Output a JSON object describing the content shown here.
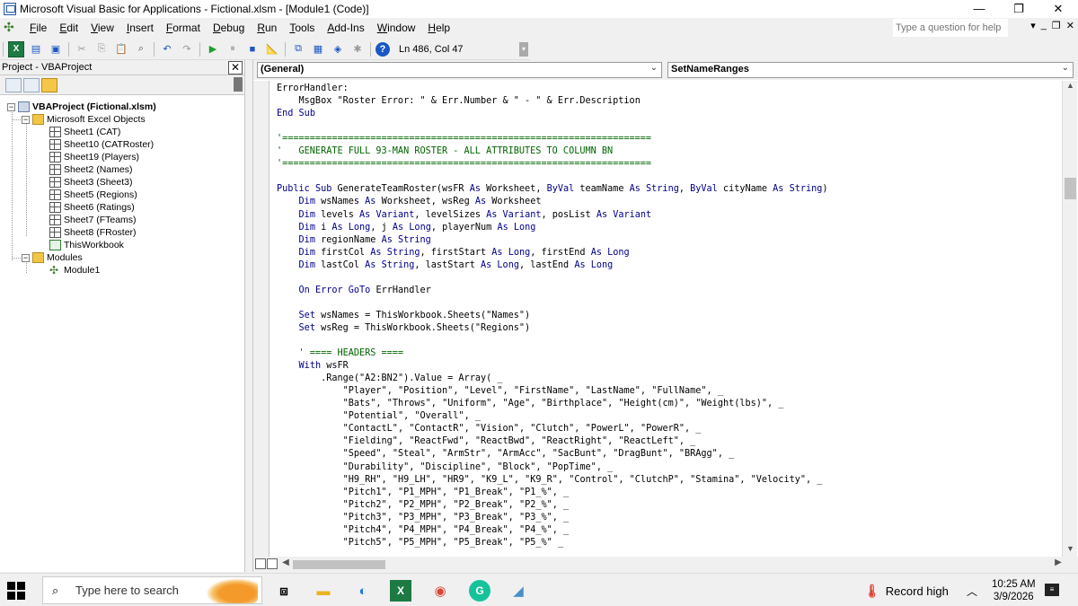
{
  "window": {
    "title": "Microsoft Visual Basic for Applications - Fictional.xlsm - [Module1 (Code)]",
    "controls": {
      "minimize": "—",
      "restore": "❐",
      "close": "✕"
    }
  },
  "menubar": {
    "items": [
      "File",
      "Edit",
      "View",
      "Insert",
      "Format",
      "Debug",
      "Run",
      "Tools",
      "Add-Ins",
      "Window",
      "Help"
    ],
    "help_placeholder": "Type a question for help",
    "mdi": {
      "dropdown": "▾",
      "minimize": "_",
      "restore": "❐",
      "close": "✕"
    }
  },
  "toolbar": {
    "cursor_position": "Ln 486, Col 47",
    "icons": [
      "excel-view-icon",
      "insert-module-icon",
      "save-icon",
      "cut-icon",
      "copy-icon",
      "paste-icon",
      "find-icon",
      "undo-icon",
      "redo-icon",
      "run-icon",
      "break-icon",
      "reset-icon",
      "design-mode-icon",
      "project-explorer-icon",
      "properties-icon",
      "object-browser-icon",
      "toolbox-icon",
      "help-icon"
    ]
  },
  "project_panel": {
    "title": "Project - VBAProject",
    "close_label": "✕",
    "tree": [
      {
        "label": "VBAProject (Fictional.xlsm)",
        "icon": "project",
        "expander": "−",
        "bold": true
      },
      {
        "label": "Microsoft Excel Objects",
        "icon": "folder",
        "expander": "−"
      },
      {
        "label": "Sheet1 (CAT)",
        "icon": "sheet"
      },
      {
        "label": "Sheet10 (CATRoster)",
        "icon": "sheet"
      },
      {
        "label": "Sheet19 (Players)",
        "icon": "sheet"
      },
      {
        "label": "Sheet2 (Names)",
        "icon": "sheet"
      },
      {
        "label": "Sheet3 (Sheet3)",
        "icon": "sheet"
      },
      {
        "label": "Sheet5 (Regions)",
        "icon": "sheet"
      },
      {
        "label": "Sheet6 (Ratings)",
        "icon": "sheet"
      },
      {
        "label": "Sheet7 (FTeams)",
        "icon": "sheet"
      },
      {
        "label": "Sheet8 (FRoster)",
        "icon": "sheet"
      },
      {
        "label": "ThisWorkbook",
        "icon": "workbook"
      },
      {
        "label": "Modules",
        "icon": "folder",
        "expander": "−"
      },
      {
        "label": "Module1",
        "icon": "module"
      }
    ]
  },
  "code_window": {
    "object_combo": "(General)",
    "procedure_combo": "SetNameRanges",
    "lines": [
      "ErrorHandler:",
      "    MsgBox \"Roster Error: \" & Err.Number & \" - \" & Err.Description",
      "End Sub",
      "",
      "'===================================================================",
      "'   GENERATE FULL 93-MAN ROSTER - ALL ATTRIBUTES TO COLUMN BN",
      "'===================================================================",
      "",
      "Public Sub GenerateTeamRoster(wsFR As Worksheet, ByVal teamName As String, ByVal cityName As String)",
      "    Dim wsNames As Worksheet, wsReg As Worksheet",
      "    Dim levels As Variant, levelSizes As Variant, posList As Variant",
      "    Dim i As Long, j As Long, playerNum As Long",
      "    Dim regionName As String",
      "    Dim firstCol As String, firstStart As Long, firstEnd As Long",
      "    Dim lastCol As String, lastStart As Long, lastEnd As Long",
      "",
      "    On Error GoTo ErrHandler",
      "",
      "    Set wsNames = ThisWorkbook.Sheets(\"Names\")",
      "    Set wsReg = ThisWorkbook.Sheets(\"Regions\")",
      "",
      "    ' ==== HEADERS ====",
      "    With wsFR",
      "        .Range(\"A2:BN2\").Value = Array( _",
      "            \"Player\", \"Position\", \"Level\", \"FirstName\", \"LastName\", \"FullName\", _",
      "            \"Bats\", \"Throws\", \"Uniform\", \"Age\", \"Birthplace\", \"Height(cm)\", \"Weight(lbs)\", _",
      "            \"Potential\", \"Overall\", _",
      "            \"ContactL\", \"ContactR\", \"Vision\", \"Clutch\", \"PowerL\", \"PowerR\", _",
      "            \"Fielding\", \"ReactFwd\", \"ReactBwd\", \"ReactRight\", \"ReactLeft\", _",
      "            \"Speed\", \"Steal\", \"ArmStr\", \"ArmAcc\", \"SacBunt\", \"DragBunt\", \"BRAgg\", _",
      "            \"Durability\", \"Discipline\", \"Block\", \"PopTime\", _",
      "            \"H9_RH\", \"H9_LH\", \"HR9\", \"K9_L\", \"K9_R\", \"Control\", \"ClutchP\", \"Stamina\", \"Velocity\", _",
      "            \"Pitch1\", \"P1_MPH\", \"P1_Break\", \"P1_%\", _",
      "            \"Pitch2\", \"P2_MPH\", \"P2_Break\", \"P2_%\", _",
      "            \"Pitch3\", \"P3_MPH\", \"P3_Break\", \"P3_%\", _",
      "            \"Pitch4\", \"P4_MPH\", \"P4_Break\", \"P4_%\", _",
      "            \"Pitch5\", \"P5_MPH\", \"P5_Break\", \"P5_%\" _"
    ]
  },
  "taskbar": {
    "search_placeholder": "Type here to search",
    "apps": [
      "task-view-icon",
      "file-explorer-icon",
      "edge-icon",
      "excel-icon",
      "chrome-icon",
      "grammarly-icon",
      "app-icon"
    ],
    "weather": "Record high",
    "time": "10:25 AM",
    "date": "3/9/2026"
  },
  "colors": {
    "keyword": "#00008b",
    "comment": "#006400",
    "accent": "#3a7bd5"
  }
}
